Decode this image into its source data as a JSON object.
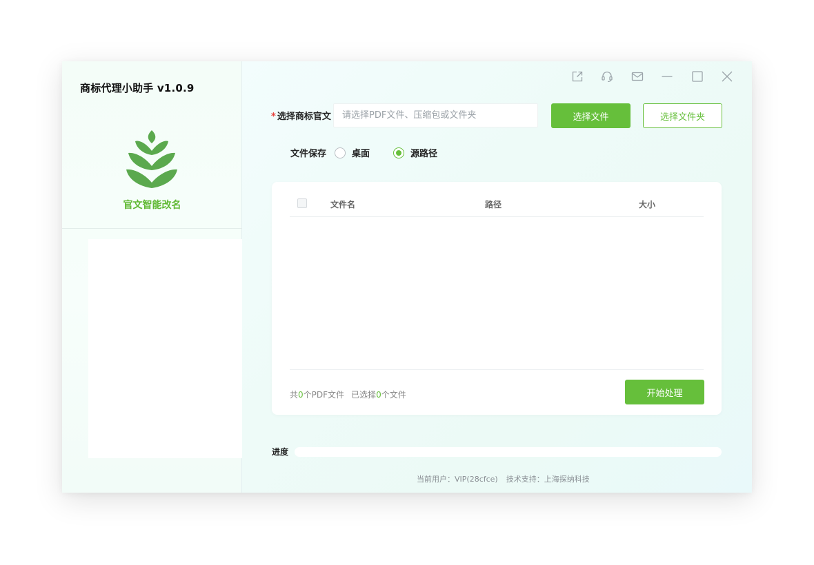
{
  "sidebar": {
    "app_title": "商标代理小助手 v1.0.9",
    "logo_icon": "leaf-logo-icon",
    "feature_label": "官文智能改名"
  },
  "titlebar": {
    "icons": [
      "external-link-icon",
      "headset-icon",
      "mail-icon",
      "minimize-icon",
      "maximize-icon",
      "close-icon"
    ]
  },
  "file_select": {
    "required_mark": "*",
    "label": "选择商标官文",
    "value": "",
    "placeholder": "请选择PDF文件、压缩包或文件夹",
    "select_file_label": "选择文件",
    "select_folder_label": "选择文件夹"
  },
  "save_option": {
    "label": "文件保存",
    "options": [
      {
        "label": "桌面",
        "selected": false
      },
      {
        "label": "源路径",
        "selected": true
      }
    ]
  },
  "table": {
    "columns": [
      "文件名",
      "路径",
      "大小"
    ],
    "rows": [],
    "summary": {
      "prefix": "共",
      "pdf_count": "0",
      "pdf_suffix": "个PDF文件",
      "selected_prefix": "已选择",
      "selected_count": "0",
      "selected_suffix": "个文件"
    },
    "start_label": "开始处理"
  },
  "progress": {
    "label": "进度",
    "value": 0
  },
  "footer": {
    "user": "当前用户：VIP(28cfce)",
    "support": "技术支持：上海探纳科技"
  },
  "colors": {
    "accent": "#66bf3b",
    "required": "#e8403a"
  }
}
